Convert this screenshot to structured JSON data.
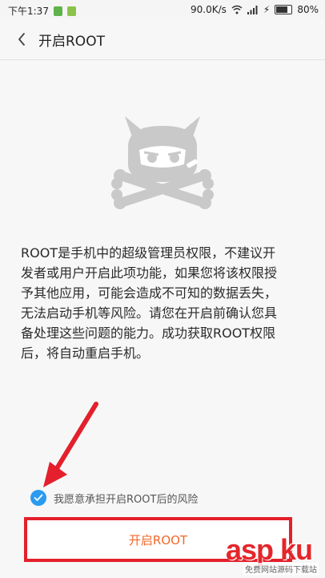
{
  "status_bar": {
    "time": "下午1:37",
    "speed": "90.0K/s",
    "battery": "80%"
  },
  "header": {
    "title": "开启ROOT"
  },
  "description": "ROOT是手机中的超级管理员权限，不建议开\n发者或用户开启此项功能，如果您将该权限授\n予其他应用，可能会造成不可知的数据丢失，\n无法启动手机等风险。请您在开启前确认您具\n备处理这些问题的能力。成功获取ROOT权限\n后，将自动重启手机。",
  "consent": {
    "label": "我愿意承担开启ROOT后的风险",
    "checked": true
  },
  "button": {
    "label": "开启ROOT"
  },
  "watermark": {
    "main": "asp ku",
    "sub": "免费网站源码下载站"
  },
  "colors": {
    "accent_blue": "#2b9bf0",
    "button_text": "#f2682a",
    "annotation_red": "#e3202b",
    "mascot_gray": "#c9c9c9"
  },
  "icons": {
    "back": "chevron-left-icon",
    "checkbox": "check-icon",
    "mascot": "mi-bunny-skull-icon"
  }
}
